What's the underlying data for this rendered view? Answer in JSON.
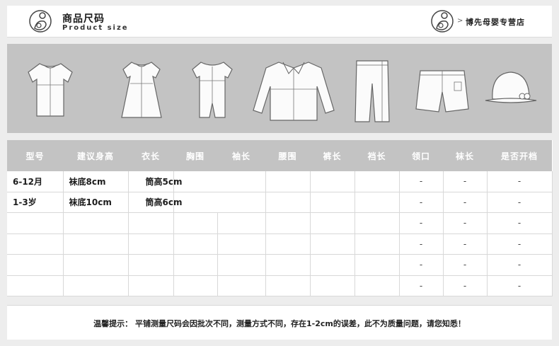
{
  "header": {
    "title_cn": "商品尺码",
    "title_en": "Product size",
    "shop_name": "博先母婴专营店",
    "arrow": ">"
  },
  "garments": [
    "tshirt-icon",
    "dress-icon",
    "romper-icon",
    "jacket-icon",
    "pants-icon",
    "shorts-icon",
    "hat-icon"
  ],
  "table": {
    "headers": [
      "型号",
      "建议身高",
      "衣长",
      "胸围",
      "袖长",
      "腰围",
      "裤长",
      "裆长",
      "领口",
      "袜长",
      "是否开档"
    ],
    "rows": [
      [
        "6-12月",
        "袜底8cm",
        "",
        "筒高5cm",
        "",
        "",
        "",
        "",
        "-",
        "-",
        "-"
      ],
      [
        "1-3岁",
        "袜底10cm",
        "",
        "筒高6cm",
        "",
        "",
        "",
        "",
        "-",
        "-",
        "-"
      ],
      [
        "",
        "",
        "",
        "",
        "",
        "",
        "",
        "",
        "-",
        "-",
        "-"
      ],
      [
        "",
        "",
        "",
        "",
        "",
        "",
        "",
        "",
        "-",
        "-",
        "-"
      ],
      [
        "",
        "",
        "",
        "",
        "",
        "",
        "",
        "",
        "-",
        "-",
        "-"
      ],
      [
        "",
        "",
        "",
        "",
        "",
        "",
        "",
        "",
        "-",
        "-",
        "-"
      ]
    ]
  },
  "note": "温馨提示： 平铺测量尺码会因批次不同，测量方式不同，存在1-2cm的误差，此不为质量问题，请您知悉！",
  "colors": {
    "band": "#c3c3c3",
    "header_bg": "#ffffff",
    "page_bg": "#ededed"
  }
}
